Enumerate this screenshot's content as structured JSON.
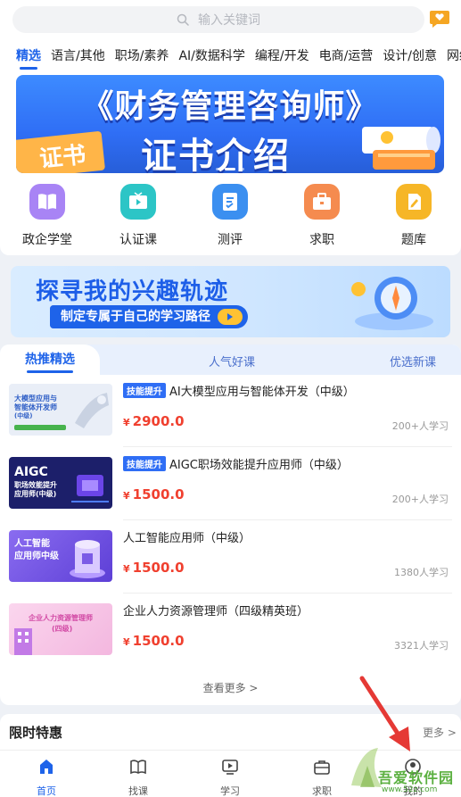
{
  "search": {
    "placeholder": "输入关键词"
  },
  "categories": [
    "精选",
    "语言/其他",
    "职场/素养",
    "AI/数据科学",
    "编程/开发",
    "电商/运营",
    "设计/创意",
    "网络"
  ],
  "banner": {
    "title": "《财务管理咨询师》",
    "subtitle": "证书介绍",
    "badge": "证书"
  },
  "quick_entries": [
    {
      "label": "政企学堂",
      "color": "#9f7cf2",
      "icon": "book-icon"
    },
    {
      "label": "认证课",
      "color": "#29c3c7",
      "icon": "tv-icon"
    },
    {
      "label": "测评",
      "color": "#3b8ff0",
      "icon": "doc-check-icon"
    },
    {
      "label": "求职",
      "color": "#f58b4f",
      "icon": "briefcase-icon"
    },
    {
      "label": "题库",
      "color": "#f6b627",
      "icon": "pen-icon"
    }
  ],
  "interest": {
    "title": "探寻我的兴趣轨迹",
    "button": "制定专属于自己的学习路径"
  },
  "course_tabs": [
    "热推精选",
    "人气好课",
    "优选新课"
  ],
  "courses": [
    {
      "tag": "技能提升",
      "title": "AI大模型应用与智能体开发（中级）",
      "currency": "¥",
      "price": "2900.0",
      "learners": "200+人学习",
      "thumb_lines": [
        "大模型应用与",
        "智能体开发师",
        "(中级)"
      ],
      "thumb_bg": "#e9eef7",
      "thumb_fg": "#2e5ec6"
    },
    {
      "tag": "技能提升",
      "title": "AIGC职场效能提升应用师（中级）",
      "currency": "¥",
      "price": "1500.0",
      "learners": "200+人学习",
      "thumb_lines": [
        "AIGC",
        "职场效能提升",
        "应用师(中级)"
      ],
      "thumb_bg": "#1c1f6a",
      "thumb_fg": "#ffffff"
    },
    {
      "tag": "",
      "title": "人工智能应用师（中级）",
      "currency": "¥",
      "price": "1500.0",
      "learners": "1380人学习",
      "thumb_lines": [
        "人工智能",
        "应用师中级"
      ],
      "thumb_bg": "#7b5be6",
      "thumb_fg": "#ffffff"
    },
    {
      "tag": "",
      "title": "企业人力资源管理师（四级精英班）",
      "currency": "¥",
      "price": "1500.0",
      "learners": "3321人学习",
      "thumb_lines": [
        "企业人力资源管理师",
        "(四级)"
      ],
      "thumb_bg": "#f6c9e6",
      "thumb_fg": "#d24aa5"
    }
  ],
  "view_more": "查看更多 >",
  "limited": {
    "title": "限时特惠",
    "more": "更多 >"
  },
  "tabbar": [
    {
      "label": "首页",
      "icon": "home-icon",
      "active": true
    },
    {
      "label": "找课",
      "icon": "open-book-icon",
      "active": false
    },
    {
      "label": "学习",
      "icon": "play-screen-icon",
      "active": false
    },
    {
      "label": "求职",
      "icon": "bag-icon",
      "active": false
    },
    {
      "label": "我的",
      "icon": "user-icon",
      "active": false
    }
  ],
  "watermark": {
    "text": "吾爱软件园",
    "url": "www.52z.com"
  }
}
